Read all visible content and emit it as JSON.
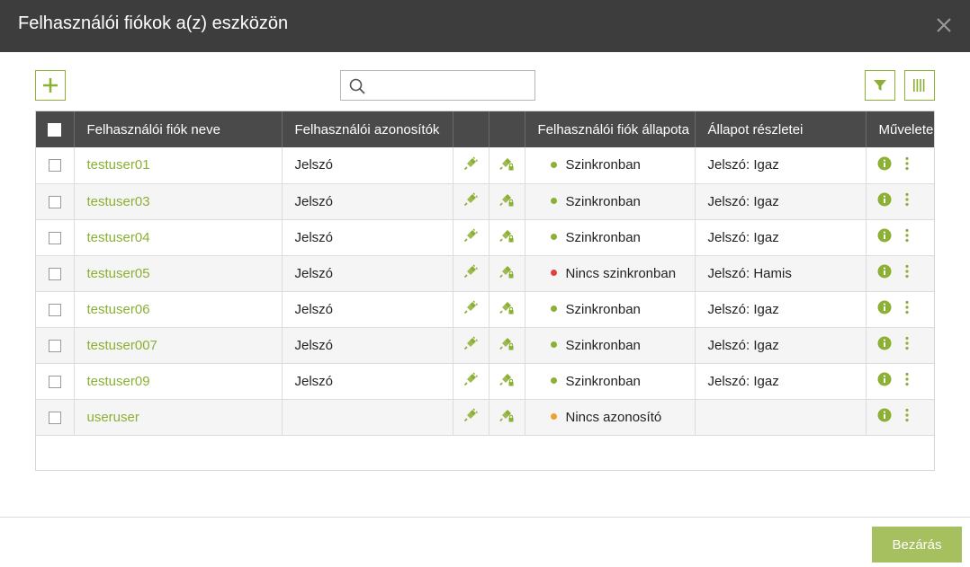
{
  "dialog": {
    "title": "Felhasználói fiókok a(z) eszközön"
  },
  "search": {
    "placeholder": "",
    "value": ""
  },
  "colors": {
    "header_bg": "#3d3d3d",
    "accent": "#8bb033",
    "table_header_bg": "#4a4a4a",
    "status_in_sync": "#8bb033",
    "status_out_of_sync": "#e04040",
    "status_no_credential": "#f0a030",
    "close_button": "#a6c05f"
  },
  "table": {
    "columns": [
      "Felhasználói fiók neve",
      "Felhasználói azonosítók",
      "",
      "",
      "Felhasználói fiók állapota",
      "Állapot részletei",
      "Műveletek"
    ],
    "rows": [
      {
        "name": "testuser01",
        "credential": "Jelszó",
        "status": "Szinkronban",
        "status_kind": "ok",
        "details": "Jelszó: Igaz"
      },
      {
        "name": "testuser03",
        "credential": "Jelszó",
        "status": "Szinkronban",
        "status_kind": "ok",
        "details": "Jelszó: Igaz"
      },
      {
        "name": "testuser04",
        "credential": "Jelszó",
        "status": "Szinkronban",
        "status_kind": "ok",
        "details": "Jelszó: Igaz"
      },
      {
        "name": "testuser05",
        "credential": "Jelszó",
        "status": "Nincs szinkronban",
        "status_kind": "error",
        "details": "Jelszó: Hamis"
      },
      {
        "name": "testuser06",
        "credential": "Jelszó",
        "status": "Szinkronban",
        "status_kind": "ok",
        "details": "Jelszó: Igaz"
      },
      {
        "name": "testuser007",
        "credential": "Jelszó",
        "status": "Szinkronban",
        "status_kind": "ok",
        "details": "Jelszó: Igaz"
      },
      {
        "name": "testuser09",
        "credential": "Jelszó",
        "status": "Szinkronban",
        "status_kind": "ok",
        "details": "Jelszó: Igaz"
      },
      {
        "name": "useruser",
        "credential": "",
        "status": "Nincs azonosító",
        "status_kind": "warning",
        "details": ""
      }
    ]
  },
  "icons": {
    "add": "plus-icon",
    "search": "search-icon",
    "filter": "filter-icon",
    "columns": "columns-icon",
    "close": "close-icon",
    "connect": "plug-icon",
    "connect_locked": "plug-lock-icon",
    "info": "info-icon",
    "more": "more-vertical-icon"
  },
  "footer": {
    "close_label": "Bezárás"
  }
}
